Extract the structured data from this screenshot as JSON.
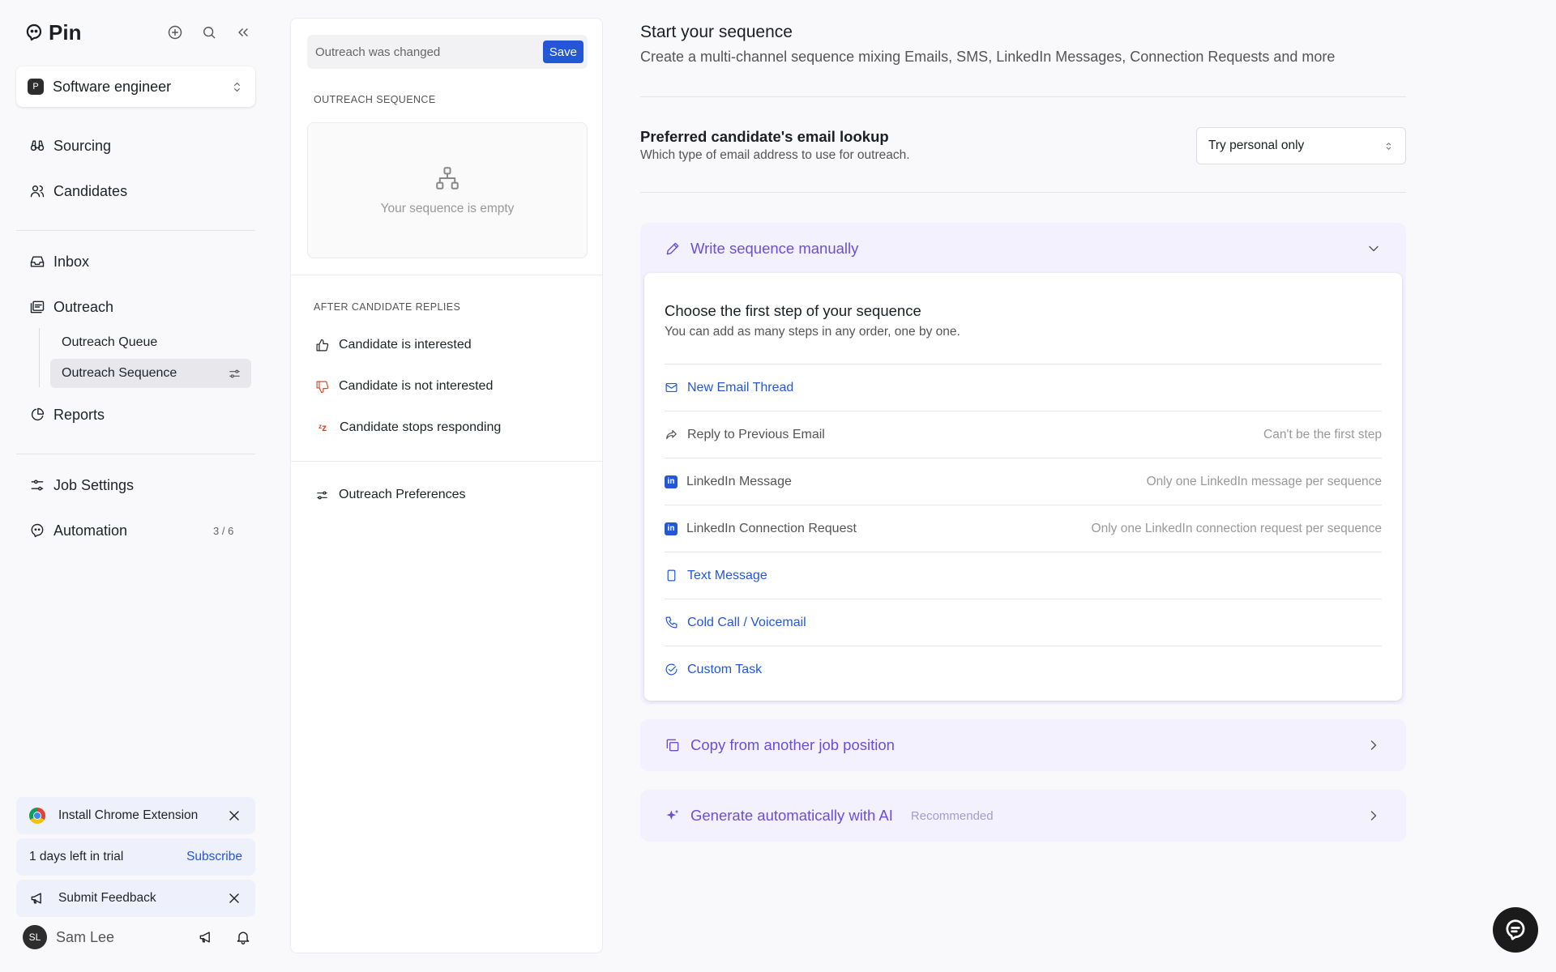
{
  "app": {
    "name": "Pin"
  },
  "sidebar": {
    "job": {
      "badge": "P",
      "name": "Software engineer"
    },
    "nav": {
      "sourcing": "Sourcing",
      "candidates": "Candidates",
      "inbox": "Inbox",
      "outreach": "Outreach",
      "outreach_queue": "Outreach Queue",
      "outreach_sequence": "Outreach Sequence",
      "reports": "Reports",
      "job_settings": "Job Settings",
      "automation": "Automation",
      "automation_count": "3 / 6"
    },
    "promos": {
      "chrome": "Install Chrome Extension",
      "trial": "1 days left in trial",
      "subscribe": "Subscribe",
      "feedback": "Submit Feedback"
    },
    "user": {
      "initials": "SL",
      "name": "Sam Lee"
    }
  },
  "middle": {
    "changed_text": "Outreach was changed",
    "save_label": "Save",
    "sequence_label": "OUTREACH SEQUENCE",
    "empty_text": "Your sequence is empty",
    "after_label": "AFTER CANDIDATE REPLIES",
    "replies": {
      "interested": "Candidate is interested",
      "not_interested": "Candidate is not interested",
      "stops": "Candidate stops responding"
    },
    "preferences": "Outreach Preferences"
  },
  "main": {
    "title": "Start your sequence",
    "subtitle": "Create a multi-channel sequence mixing Emails, SMS, LinkedIn Messages, Connection Requests and more",
    "pref": {
      "title": "Preferred candidate's email lookup",
      "subtitle": "Which type of email address to use for outreach.",
      "selected": "Try personal only"
    },
    "manual": {
      "label": "Write sequence manually",
      "step_title": "Choose the first step of your sequence",
      "step_sub": "You can add as many steps in any order, one by one.",
      "steps": [
        {
          "label": "New Email Thread",
          "note": ""
        },
        {
          "label": "Reply to Previous Email",
          "note": "Can't be the first step"
        },
        {
          "label": "LinkedIn Message",
          "note": "Only one LinkedIn message per sequence"
        },
        {
          "label": "LinkedIn Connection Request",
          "note": "Only one LinkedIn connection request per sequence"
        },
        {
          "label": "Text Message",
          "note": ""
        },
        {
          "label": "Cold Call / Voicemail",
          "note": ""
        },
        {
          "label": "Custom Task",
          "note": ""
        }
      ]
    },
    "copy_label": "Copy from another job position",
    "ai_label": "Generate automatically with AI",
    "ai_badge": "Recommended"
  },
  "colors": {
    "accent": "#2457d6",
    "purple": "#6b4fd8",
    "lavender": "#f3f1fd"
  }
}
